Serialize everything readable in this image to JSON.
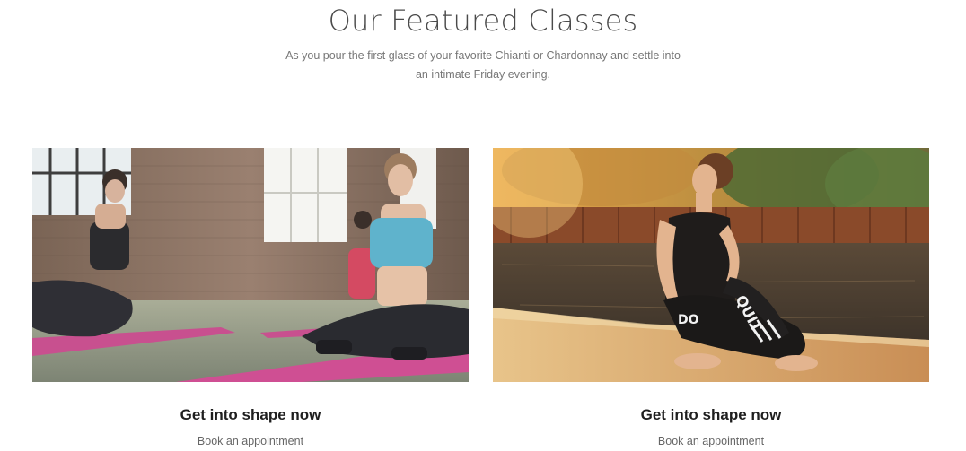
{
  "section": {
    "title": "Our Featured Classes",
    "subtitle_line1": "As you pour the first glass of your favorite Chianti or Chardonnay and settle into",
    "subtitle_line2": "an intimate Friday evening."
  },
  "cards": [
    {
      "title": "Get into shape now",
      "link": "Book an appointment",
      "image": "photo-group-yoga-indoor-brick-studio"
    },
    {
      "title": "Get into shape now",
      "link": "Book an appointment",
      "image": "photo-woman-yoga-twist-riverside-sunset"
    }
  ],
  "colors": {
    "title": "#4a4a4a",
    "subtitle": "#777777",
    "card_title": "#1f1f1f",
    "mat_pink": "#c8508f",
    "top_teal": "#5fb3cc",
    "sunset_orange": "#d99a45"
  }
}
